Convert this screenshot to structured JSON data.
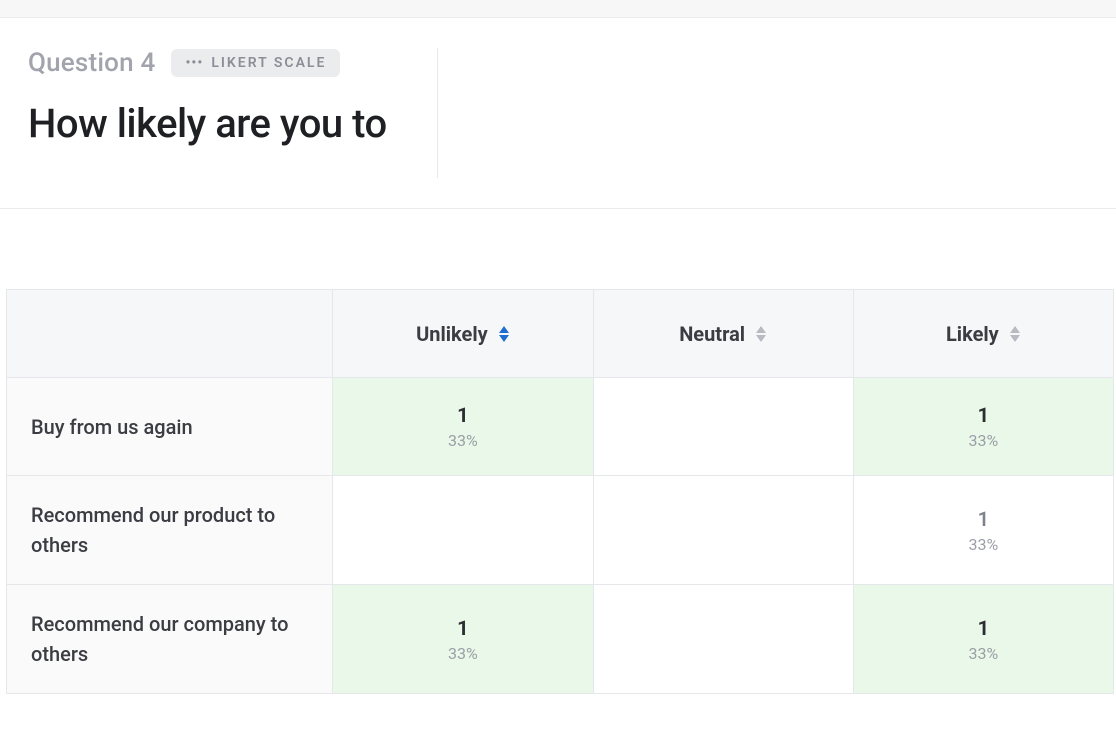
{
  "header": {
    "question_label": "Question 4",
    "type_badge": "LIKERT SCALE",
    "question_title": "How likely are you to"
  },
  "table": {
    "columns": [
      {
        "label": "Unlikely",
        "sort_active": true
      },
      {
        "label": "Neutral",
        "sort_active": false
      },
      {
        "label": "Likely",
        "sort_active": false
      }
    ],
    "rows": [
      {
        "label": "Buy from us again",
        "cells": [
          {
            "count": "1",
            "pct": "33%",
            "highlight": true,
            "muted": false,
            "has_value": true
          },
          {
            "count": "",
            "pct": "",
            "highlight": false,
            "muted": false,
            "has_value": false
          },
          {
            "count": "1",
            "pct": "33%",
            "highlight": true,
            "muted": false,
            "has_value": true
          }
        ]
      },
      {
        "label": "Recommend our product to others",
        "cells": [
          {
            "count": "",
            "pct": "",
            "highlight": false,
            "muted": false,
            "has_value": false
          },
          {
            "count": "",
            "pct": "",
            "highlight": false,
            "muted": false,
            "has_value": false
          },
          {
            "count": "1",
            "pct": "33%",
            "highlight": false,
            "muted": true,
            "has_value": true
          }
        ]
      },
      {
        "label": "Recommend our company to others",
        "cells": [
          {
            "count": "1",
            "pct": "33%",
            "highlight": true,
            "muted": false,
            "has_value": true
          },
          {
            "count": "",
            "pct": "",
            "highlight": false,
            "muted": false,
            "has_value": false
          },
          {
            "count": "1",
            "pct": "33%",
            "highlight": true,
            "muted": false,
            "has_value": true
          }
        ]
      }
    ]
  }
}
